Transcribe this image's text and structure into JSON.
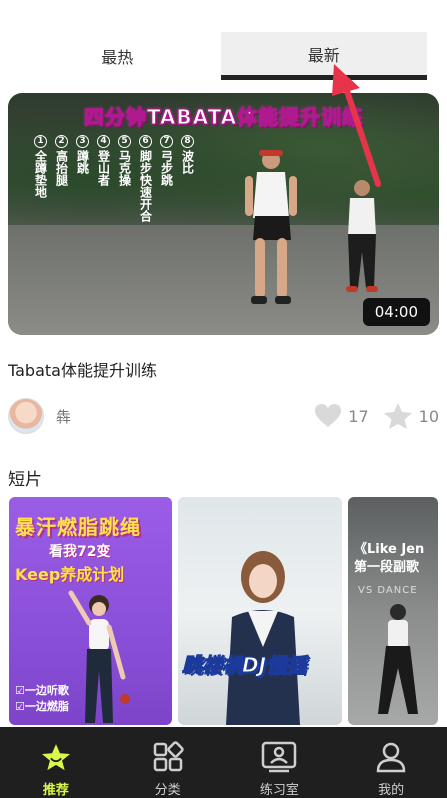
{
  "tabs": [
    {
      "label": "最热",
      "active": false
    },
    {
      "label": "最新",
      "active": true
    }
  ],
  "featured_video": {
    "overlay_title": "四分钟TABATA体能提升训练",
    "moves": [
      {
        "num": "1",
        "text": "全蹲垫地"
      },
      {
        "num": "2",
        "text": "高抬腿"
      },
      {
        "num": "3",
        "text": "蹲跳"
      },
      {
        "num": "4",
        "text": "登山者"
      },
      {
        "num": "5",
        "text": "马克操"
      },
      {
        "num": "6",
        "text": "脚步快速开合"
      },
      {
        "num": "7",
        "text": "弓步跳"
      },
      {
        "num": "8",
        "text": "波比"
      }
    ],
    "duration": "04:00",
    "caption": "Tabata体能提升训练",
    "author": "犇",
    "likes": "17",
    "favorites": "10"
  },
  "shorts_section": {
    "title": "短片",
    "items": [
      {
        "title": "暴汗燃脂跳绳",
        "subtitle": "看我72变",
        "subtitle2": "Keep养成计划",
        "side_notes": [
          "☑一边听歌",
          "☑一边燃脂"
        ]
      },
      {
        "title": "跳楼机DJ慢摇"
      },
      {
        "title": "《Like Jen",
        "title2": "第一段副歌",
        "subtitle": "VS DANCE"
      }
    ]
  },
  "bottom_nav": [
    {
      "label": "推荐",
      "icon": "star-icon",
      "active": true
    },
    {
      "label": "分类",
      "icon": "category-grid-icon",
      "active": false
    },
    {
      "label": "练习室",
      "icon": "practice-room-icon",
      "active": false
    },
    {
      "label": "我的",
      "icon": "profile-icon",
      "active": false
    }
  ],
  "colors": {
    "accent": "#d8f94a",
    "annotation_arrow": "#e8344a",
    "nav_bg": "#1f1f1f"
  }
}
